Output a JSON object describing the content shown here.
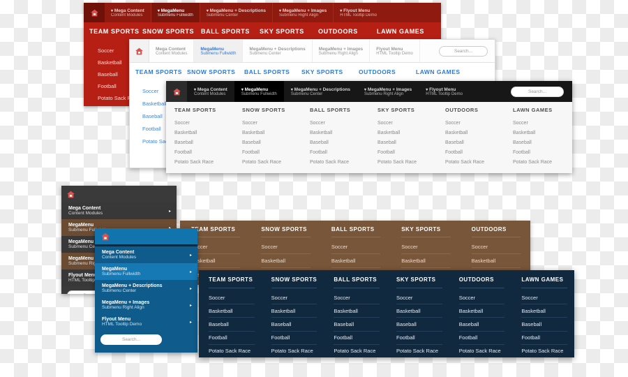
{
  "topbar_items": [
    {
      "line1": "Mega Content",
      "line2": "Content Modules",
      "caret": "▾"
    },
    {
      "line1": "MegaMenu",
      "line2": "Submenu Fullwidth",
      "caret": "▾"
    },
    {
      "line1": "MegaMenu + Descriptions",
      "line2": "Submenu Center",
      "caret": "▾"
    },
    {
      "line1": "MegaMenu + Images",
      "line2": "Submenu Right Align",
      "caret": "▾"
    },
    {
      "line1": "Flyout Menu",
      "line2": "HTML Tooltip Demo",
      "caret": "▾"
    }
  ],
  "nav_categories": [
    "TEAM SPORTS",
    "SNOW SPORTS",
    "BALL SPORTS",
    "SKY SPORTS",
    "OUTDOORS",
    "LAWN GAMES"
  ],
  "sports_items": [
    "Soccer",
    "Basketball",
    "Baseball",
    "Football",
    "Potato Sack Race"
  ],
  "search": {
    "placeholder": "Search...",
    "value": ""
  },
  "icons": {
    "home": "home-icon",
    "caret_down": "▾",
    "arrow_right": "▸"
  },
  "colors": {
    "red": "#b61f14",
    "red_dark": "#8e1a10",
    "light_accent": "#2b7bdd",
    "dark": "#171717",
    "brown": "#78563a",
    "blue": "#0f5c8c",
    "navy": "#11293f"
  },
  "panels": {
    "red": {
      "name": "Red mega menu",
      "columns": 6
    },
    "light": {
      "name": "Light mega menu",
      "columns": 6
    },
    "dark": {
      "name": "Dark mega menu",
      "columns": 6
    },
    "vgray": {
      "name": "Gray vertical menu",
      "columns": 0
    },
    "vblue": {
      "name": "Blue vertical menu",
      "columns": 0
    },
    "brown": {
      "name": "Brown mega menu",
      "columns": 6
    },
    "navy": {
      "name": "Navy mega menu",
      "columns": 6
    }
  }
}
